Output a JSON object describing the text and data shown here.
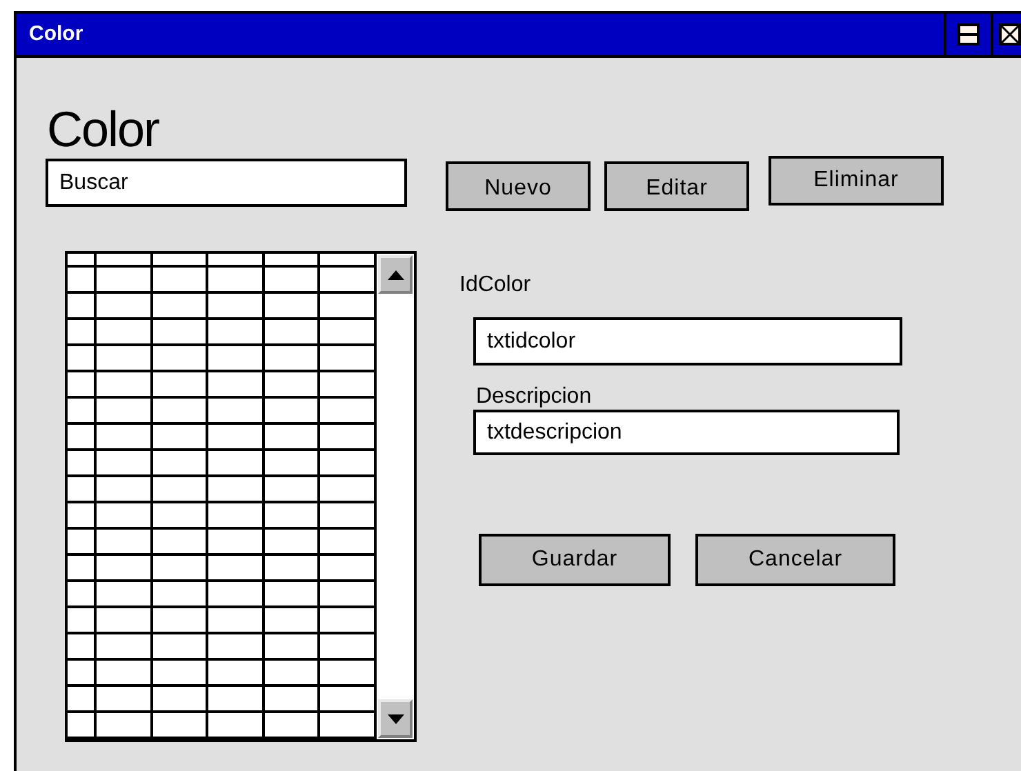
{
  "window": {
    "title": "Color"
  },
  "heading": "Color",
  "search": {
    "value": "Buscar"
  },
  "toolbar_buttons": [
    "Nuevo",
    "Editar",
    "Eliminar"
  ],
  "form": {
    "fields": [
      {
        "label": "IdColor",
        "value": "txtidcolor"
      },
      {
        "label": "Descripcion",
        "value": "txtdescripcion"
      }
    ],
    "buttons": [
      "Guardar",
      "Cancelar"
    ]
  }
}
